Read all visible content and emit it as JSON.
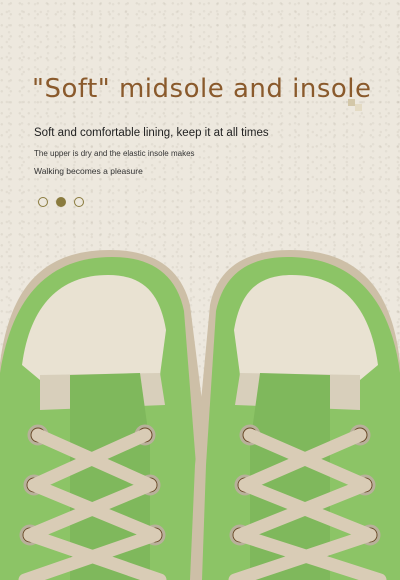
{
  "headline": "\"Soft\" midsole and insole",
  "subtitle": "Soft and comfortable lining, keep it at all times",
  "body_lines": [
    "The upper is dry and the elastic insole makes",
    "Walking becomes a pleasure"
  ],
  "carousel": {
    "count": 3,
    "active_index": 1
  },
  "colors": {
    "background": "#ede8de",
    "headline": "#8a5a2c",
    "dot": "#8a7b3e",
    "shoe_leather": "#8cc466",
    "insole": "#e9e2d2",
    "laces": "#d9ccb6",
    "sole": "#cdbfa7"
  },
  "image": {
    "icon": "green-leather-sneakers-photo"
  }
}
